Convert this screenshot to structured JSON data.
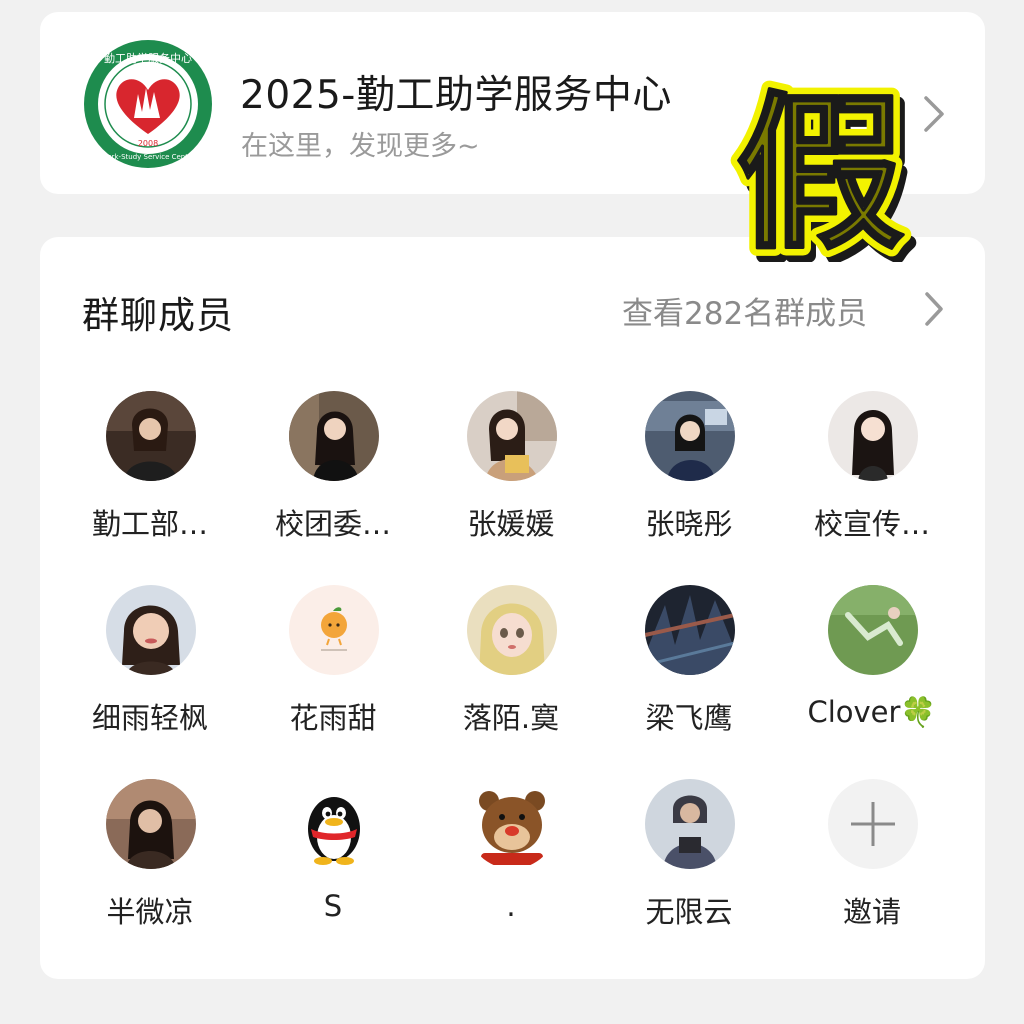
{
  "header": {
    "title": "2025-勤工助学服务中心",
    "subtitle": "在这里，发现更多~",
    "logo": {
      "top_text": "勤工助学服务中心",
      "year": "2008",
      "bottom_text": "Work-Study Service Center"
    }
  },
  "overlay": {
    "stamp_text": "假",
    "stamp_color": "#e6e600",
    "stamp_outline": "#1a1a1a"
  },
  "members": {
    "heading": "群聊成员",
    "view_all_label": "查看282名群成员",
    "list": [
      {
        "name": "勤工部…",
        "avatar": "photo-avatar"
      },
      {
        "name": "校团委…",
        "avatar": "photo-avatar"
      },
      {
        "name": "张媛媛",
        "avatar": "photo-avatar"
      },
      {
        "name": "张晓彤",
        "avatar": "photo-avatar"
      },
      {
        "name": "校宣传…",
        "avatar": "photo-avatar"
      },
      {
        "name": "细雨轻枫",
        "avatar": "photo-avatar"
      },
      {
        "name": "花雨甜",
        "avatar": "orange-cartoon-avatar"
      },
      {
        "name": "落陌.寞",
        "avatar": "doll-avatar"
      },
      {
        "name": "梁飞鹰",
        "avatar": "photo-avatar"
      },
      {
        "name": "Clover🍀",
        "avatar": "photo-avatar"
      },
      {
        "name": "半微凉",
        "avatar": "photo-avatar"
      },
      {
        "name": "S",
        "avatar": "penguin-avatar"
      },
      {
        "name": ".",
        "avatar": "bear-cartoon-avatar"
      },
      {
        "name": "无限云",
        "avatar": "photo-avatar"
      }
    ],
    "invite_label": "邀请"
  },
  "colors": {
    "background": "#f1f1f1",
    "card": "#ffffff",
    "logo_green": "#1e8c4e",
    "logo_red": "#d8262e"
  }
}
